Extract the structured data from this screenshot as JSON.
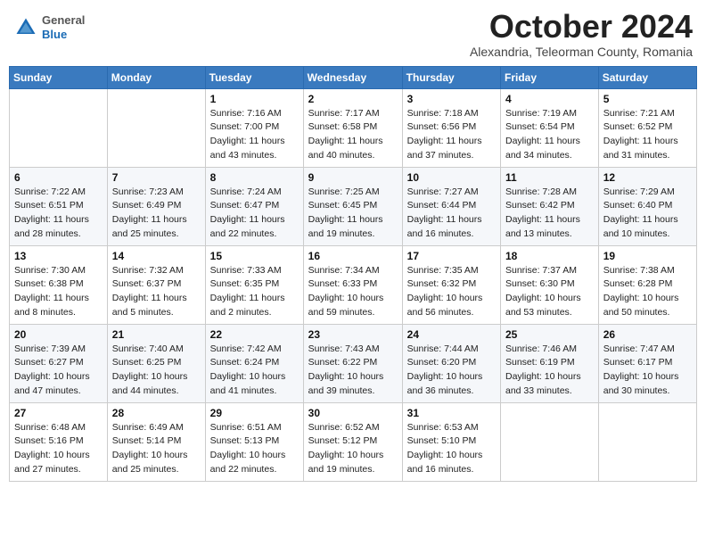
{
  "header": {
    "logo": {
      "general": "General",
      "blue": "Blue"
    },
    "month": "October 2024",
    "location": "Alexandria, Teleorman County, Romania"
  },
  "weekdays": [
    "Sunday",
    "Monday",
    "Tuesday",
    "Wednesday",
    "Thursday",
    "Friday",
    "Saturday"
  ],
  "weeks": [
    [
      {
        "day": "",
        "info": ""
      },
      {
        "day": "",
        "info": ""
      },
      {
        "day": "1",
        "info": "Sunrise: 7:16 AM\nSunset: 7:00 PM\nDaylight: 11 hours\nand 43 minutes."
      },
      {
        "day": "2",
        "info": "Sunrise: 7:17 AM\nSunset: 6:58 PM\nDaylight: 11 hours\nand 40 minutes."
      },
      {
        "day": "3",
        "info": "Sunrise: 7:18 AM\nSunset: 6:56 PM\nDaylight: 11 hours\nand 37 minutes."
      },
      {
        "day": "4",
        "info": "Sunrise: 7:19 AM\nSunset: 6:54 PM\nDaylight: 11 hours\nand 34 minutes."
      },
      {
        "day": "5",
        "info": "Sunrise: 7:21 AM\nSunset: 6:52 PM\nDaylight: 11 hours\nand 31 minutes."
      }
    ],
    [
      {
        "day": "6",
        "info": "Sunrise: 7:22 AM\nSunset: 6:51 PM\nDaylight: 11 hours\nand 28 minutes."
      },
      {
        "day": "7",
        "info": "Sunrise: 7:23 AM\nSunset: 6:49 PM\nDaylight: 11 hours\nand 25 minutes."
      },
      {
        "day": "8",
        "info": "Sunrise: 7:24 AM\nSunset: 6:47 PM\nDaylight: 11 hours\nand 22 minutes."
      },
      {
        "day": "9",
        "info": "Sunrise: 7:25 AM\nSunset: 6:45 PM\nDaylight: 11 hours\nand 19 minutes."
      },
      {
        "day": "10",
        "info": "Sunrise: 7:27 AM\nSunset: 6:44 PM\nDaylight: 11 hours\nand 16 minutes."
      },
      {
        "day": "11",
        "info": "Sunrise: 7:28 AM\nSunset: 6:42 PM\nDaylight: 11 hours\nand 13 minutes."
      },
      {
        "day": "12",
        "info": "Sunrise: 7:29 AM\nSunset: 6:40 PM\nDaylight: 11 hours\nand 10 minutes."
      }
    ],
    [
      {
        "day": "13",
        "info": "Sunrise: 7:30 AM\nSunset: 6:38 PM\nDaylight: 11 hours\nand 8 minutes."
      },
      {
        "day": "14",
        "info": "Sunrise: 7:32 AM\nSunset: 6:37 PM\nDaylight: 11 hours\nand 5 minutes."
      },
      {
        "day": "15",
        "info": "Sunrise: 7:33 AM\nSunset: 6:35 PM\nDaylight: 11 hours\nand 2 minutes."
      },
      {
        "day": "16",
        "info": "Sunrise: 7:34 AM\nSunset: 6:33 PM\nDaylight: 10 hours\nand 59 minutes."
      },
      {
        "day": "17",
        "info": "Sunrise: 7:35 AM\nSunset: 6:32 PM\nDaylight: 10 hours\nand 56 minutes."
      },
      {
        "day": "18",
        "info": "Sunrise: 7:37 AM\nSunset: 6:30 PM\nDaylight: 10 hours\nand 53 minutes."
      },
      {
        "day": "19",
        "info": "Sunrise: 7:38 AM\nSunset: 6:28 PM\nDaylight: 10 hours\nand 50 minutes."
      }
    ],
    [
      {
        "day": "20",
        "info": "Sunrise: 7:39 AM\nSunset: 6:27 PM\nDaylight: 10 hours\nand 47 minutes."
      },
      {
        "day": "21",
        "info": "Sunrise: 7:40 AM\nSunset: 6:25 PM\nDaylight: 10 hours\nand 44 minutes."
      },
      {
        "day": "22",
        "info": "Sunrise: 7:42 AM\nSunset: 6:24 PM\nDaylight: 10 hours\nand 41 minutes."
      },
      {
        "day": "23",
        "info": "Sunrise: 7:43 AM\nSunset: 6:22 PM\nDaylight: 10 hours\nand 39 minutes."
      },
      {
        "day": "24",
        "info": "Sunrise: 7:44 AM\nSunset: 6:20 PM\nDaylight: 10 hours\nand 36 minutes."
      },
      {
        "day": "25",
        "info": "Sunrise: 7:46 AM\nSunset: 6:19 PM\nDaylight: 10 hours\nand 33 minutes."
      },
      {
        "day": "26",
        "info": "Sunrise: 7:47 AM\nSunset: 6:17 PM\nDaylight: 10 hours\nand 30 minutes."
      }
    ],
    [
      {
        "day": "27",
        "info": "Sunrise: 6:48 AM\nSunset: 5:16 PM\nDaylight: 10 hours\nand 27 minutes."
      },
      {
        "day": "28",
        "info": "Sunrise: 6:49 AM\nSunset: 5:14 PM\nDaylight: 10 hours\nand 25 minutes."
      },
      {
        "day": "29",
        "info": "Sunrise: 6:51 AM\nSunset: 5:13 PM\nDaylight: 10 hours\nand 22 minutes."
      },
      {
        "day": "30",
        "info": "Sunrise: 6:52 AM\nSunset: 5:12 PM\nDaylight: 10 hours\nand 19 minutes."
      },
      {
        "day": "31",
        "info": "Sunrise: 6:53 AM\nSunset: 5:10 PM\nDaylight: 10 hours\nand 16 minutes."
      },
      {
        "day": "",
        "info": ""
      },
      {
        "day": "",
        "info": ""
      }
    ]
  ]
}
